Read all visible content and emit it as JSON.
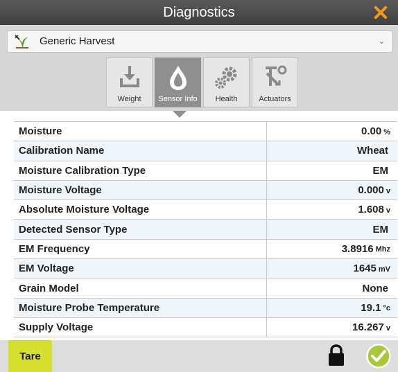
{
  "window": {
    "title": "Diagnostics"
  },
  "profile": {
    "name": "Generic Harvest",
    "icon": "harvest-plant-icon"
  },
  "tabs": [
    {
      "label": "Weight",
      "icon": "weight-scale-icon",
      "active": false
    },
    {
      "label": "Sensor Info",
      "icon": "moisture-drop-icon",
      "active": true
    },
    {
      "label": "Health",
      "icon": "gears-icon",
      "active": false
    },
    {
      "label": "Actuators",
      "icon": "actuator-icon",
      "active": false
    }
  ],
  "sensor_info": [
    {
      "label": "Moisture",
      "value": "0.00",
      "unit": "%"
    },
    {
      "label": "Calibration Name",
      "value": "Wheat",
      "unit": ""
    },
    {
      "label": "Moisture Calibration Type",
      "value": "EM",
      "unit": ""
    },
    {
      "label": "Moisture Voltage",
      "value": "0.000",
      "unit": "v"
    },
    {
      "label": "Absolute Moisture Voltage",
      "value": "1.608",
      "unit": "v"
    },
    {
      "label": "Detected Sensor Type",
      "value": "EM",
      "unit": ""
    },
    {
      "label": "EM Frequency",
      "value": "3.8916",
      "unit": "Mhz"
    },
    {
      "label": "EM Voltage",
      "value": "1645",
      "unit": "mV"
    },
    {
      "label": "Grain Model",
      "value": "None",
      "unit": ""
    },
    {
      "label": "Moisture Probe Temperature",
      "value": "19.1",
      "unit": "°c"
    },
    {
      "label": "Supply Voltage",
      "value": "16.267",
      "unit": "v"
    }
  ],
  "footer": {
    "tare_label": "Tare",
    "lock_icon": "lock-icon",
    "confirm_icon": "checkmark-icon"
  },
  "colors": {
    "accent_orange": "#f39a1e",
    "tare_yellow": "#d4df2e",
    "confirm_green": "#a8c83a",
    "active_tab": "#8f8f8f"
  }
}
